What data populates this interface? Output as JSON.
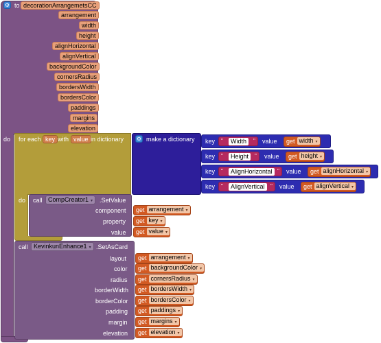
{
  "procedure": {
    "to_keyword": "to",
    "name": "decorationArrangemetsCC",
    "params": [
      "arrangement",
      "width",
      "height",
      "alignHorizontal",
      "alignVertical",
      "backgroundColor",
      "cornersRadius",
      "bordersWidth",
      "bordersColor",
      "paddings",
      "margins",
      "elevation"
    ],
    "do_keyword": "do"
  },
  "foreach": {
    "for_each": "for each",
    "item_var": "key",
    "with": "with",
    "value_var": "value",
    "in_dictionary": "in dictionary",
    "do_keyword": "do"
  },
  "dictionary": {
    "label": "make a dictionary",
    "key_label": "key",
    "value_label": "value",
    "pairs": [
      {
        "key": "Width",
        "get": "get",
        "var": "width"
      },
      {
        "key": "Height",
        "get": "get",
        "var": "height"
      },
      {
        "key": "AlignHorizontal",
        "get": "get",
        "var": "alignHorizontal"
      },
      {
        "key": "AlignVertical",
        "get": "get",
        "var": "alignVertical"
      }
    ]
  },
  "compCall": {
    "call": "call",
    "component": "CompCreator1",
    "method": ".SetValue",
    "args": [
      {
        "label": "component",
        "get": "get",
        "var": "arrangement"
      },
      {
        "label": "property",
        "get": "get",
        "var": "key"
      },
      {
        "label": "value",
        "get": "get",
        "var": "value"
      }
    ]
  },
  "cardCall": {
    "call": "call",
    "component": "KevinkunEnhance1",
    "method": ".SetAsCard",
    "args": [
      {
        "label": "layout",
        "get": "get",
        "var": "arrangement"
      },
      {
        "label": "color",
        "get": "get",
        "var": "backgroundColor"
      },
      {
        "label": "radius",
        "get": "get",
        "var": "cornersRadius"
      },
      {
        "label": "borderWidth",
        "get": "get",
        "var": "bordersWidth"
      },
      {
        "label": "borderColor",
        "get": "get",
        "var": "bordersColor"
      },
      {
        "label": "padding",
        "get": "get",
        "var": "paddings"
      },
      {
        "label": "margin",
        "get": "get",
        "var": "margins"
      },
      {
        "label": "elevation",
        "get": "get",
        "var": "elevation"
      }
    ]
  },
  "dropdown_glyph": "▾",
  "quote_glyph": "\"",
  "gear_glyph": "⚙"
}
